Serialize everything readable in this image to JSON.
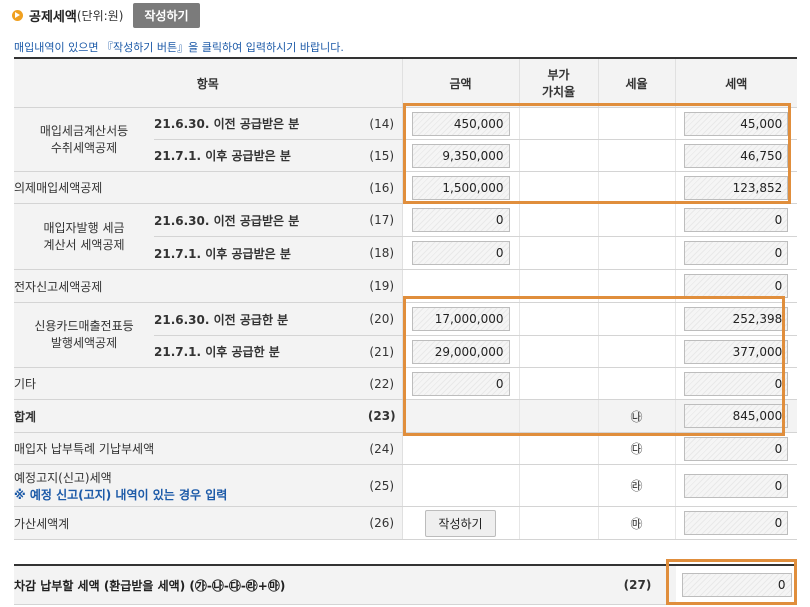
{
  "header": {
    "title": "공제세액",
    "unit": "(단위:원)",
    "write_button": "작성하기"
  },
  "notice": "매입내역이 있으면 『작성하기 버튼』을 클릭하여 입력하시기 바랍니다.",
  "columns": {
    "item": "항목",
    "amount": "금액",
    "vat_rate_line1": "부가",
    "vat_rate_line2": "가치율",
    "rate": "세율",
    "tax": "세액"
  },
  "rows": {
    "r14": {
      "group": "매입세금계산서등 수취세액공제",
      "group_line1": "매입세금계산서등",
      "group_line2": "수취세액공제",
      "sub": "21.6.30. 이전 공급받은 분",
      "no": "(14)",
      "amount": "450,000",
      "tax": "45,000"
    },
    "r15": {
      "sub": "21.7.1. 이후 공급받은 분",
      "no": "(15)",
      "amount": "9,350,000",
      "tax": "46,750"
    },
    "r16": {
      "label": "의제매입세액공제",
      "no": "(16)",
      "amount": "1,500,000",
      "tax": "123,852"
    },
    "r17": {
      "group_line1": "매입자발행 세금",
      "group_line2": "계산서 세액공제",
      "sub": "21.6.30. 이전 공급받은 분",
      "no": "(17)",
      "amount": "0",
      "tax": "0"
    },
    "r18": {
      "sub": "21.7.1. 이후 공급받은 분",
      "no": "(18)",
      "amount": "0",
      "tax": "0"
    },
    "r19": {
      "label": "전자신고세액공제",
      "no": "(19)",
      "tax": "0"
    },
    "r20": {
      "group_line1": "신용카드매출전표등",
      "group_line2": "발행세액공제",
      "sub": "21.6.30. 이전 공급한 분",
      "no": "(20)",
      "amount": "17,000,000",
      "tax": "252,398"
    },
    "r21": {
      "sub": "21.7.1. 이후 공급한 분",
      "no": "(21)",
      "amount": "29,000,000",
      "tax": "377,000"
    },
    "r22": {
      "label": "기타",
      "no": "(22)",
      "amount": "0",
      "tax": "0"
    },
    "r23": {
      "label": "합계",
      "no": "(23)",
      "rate_mark": "㉯",
      "tax": "845,000"
    },
    "r24": {
      "label": "매입자 납부특례 기납부세액",
      "no": "(24)",
      "rate_mark": "㉰",
      "tax": "0"
    },
    "r25": {
      "label": "예정고지(신고)세액",
      "note": "※ 예정 신고(고지) 내역이 있는 경우 입력",
      "no": "(25)",
      "rate_mark": "㉱",
      "tax": "0"
    },
    "r26": {
      "label": "가산세액계",
      "no": "(26)",
      "button": "작성하기",
      "rate_mark": "㉲",
      "tax": "0"
    }
  },
  "bottom": {
    "label": "차감 납부할 세액 (환급받을 세액) (㉮-㉯-㉰-㉱+㉲)",
    "no": "(27)",
    "value": "0"
  },
  "colors": {
    "highlight": "#e08e3c",
    "notice": "#1c5aa8",
    "header_bullet": "#f0a020"
  }
}
